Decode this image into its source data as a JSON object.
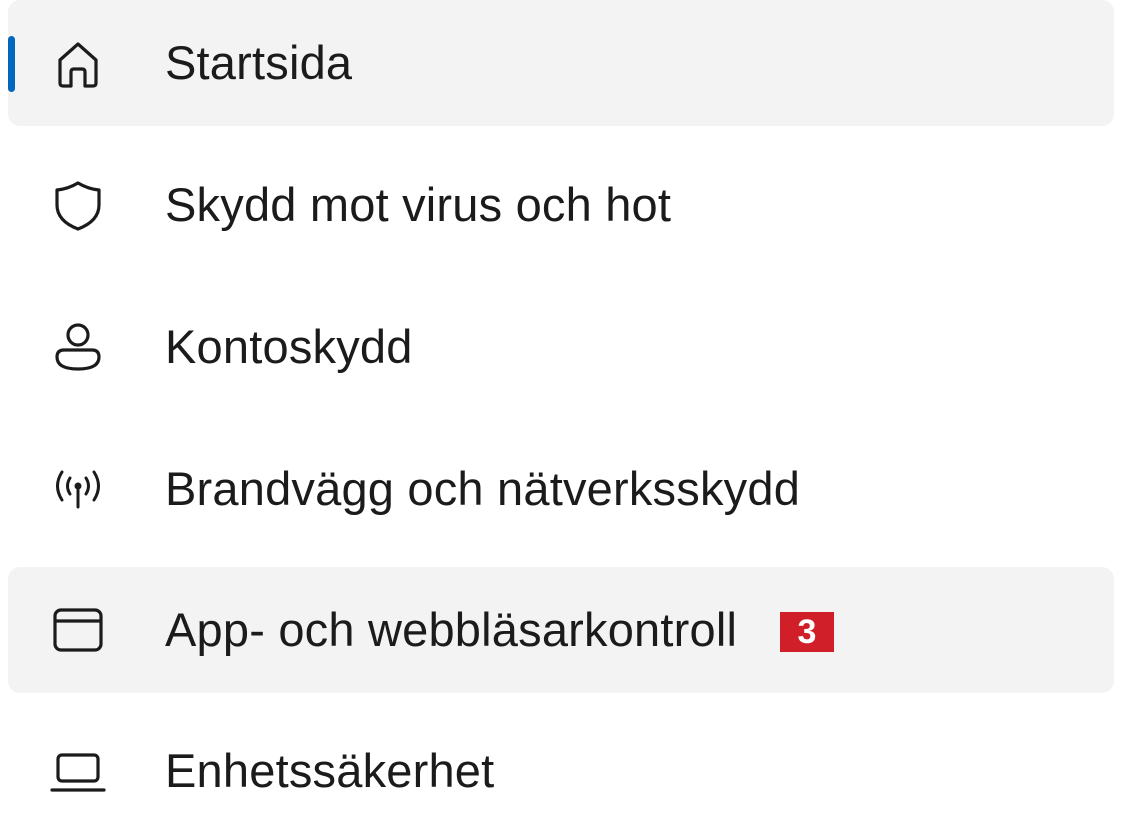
{
  "nav": {
    "items": [
      {
        "label": "Startsida",
        "icon": "home-icon",
        "selected": true
      },
      {
        "label": "Skydd mot virus och hot",
        "icon": "shield-icon"
      },
      {
        "label": "Kontoskydd",
        "icon": "person-icon"
      },
      {
        "label": "Brandvägg och nätverksskydd",
        "icon": "antenna-icon"
      },
      {
        "label": "App- och webbläsarkontroll",
        "icon": "app-window-icon",
        "badge": "3",
        "hovered": true
      },
      {
        "label": "Enhetssäkerhet",
        "icon": "laptop-icon"
      }
    ]
  },
  "colors": {
    "accent": "#0067c0",
    "highlight_bg": "#f3f3f3",
    "badge_bg": "#d11f2a",
    "text": "#1b1b1b"
  }
}
